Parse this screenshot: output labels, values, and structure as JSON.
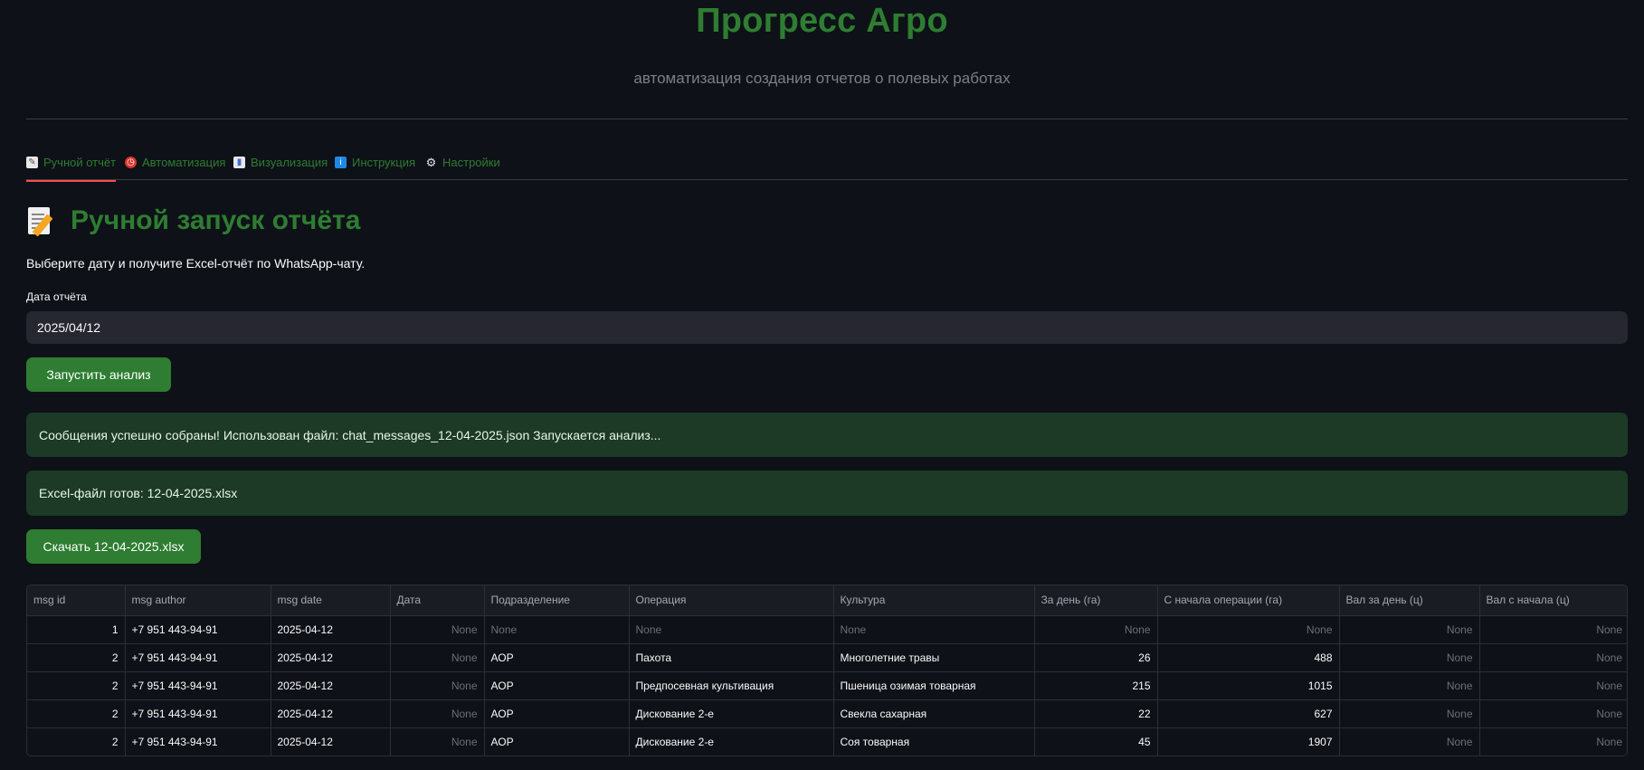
{
  "header": {
    "title": "Прогресс Агро",
    "subtitle": "автоматизация создания отчетов о полевых работах"
  },
  "tabs": [
    {
      "label": "Ручной отчёт",
      "icon": "memo-icon",
      "active": true
    },
    {
      "label": "Автоматизация",
      "icon": "alarm-clock-icon",
      "active": false
    },
    {
      "label": "Визуализация",
      "icon": "bar-chart-icon",
      "active": false
    },
    {
      "label": "Инструкция",
      "icon": "info-icon",
      "active": false
    },
    {
      "label": "Настройки",
      "icon": "gear-icon",
      "active": false
    }
  ],
  "section": {
    "title": "Ручной запуск отчёта",
    "description": "Выберите дату и получите Excel-отчёт по WhatsApp-чату."
  },
  "date_field": {
    "label": "Дата отчёта",
    "value": "2025/04/12"
  },
  "run_button_label": "Запустить анализ",
  "alerts": [
    "Сообщения успешно собраны! Использован файл: chat_messages_12-04-2025.json Запускается анализ...",
    "Excel-файл готов: 12-04-2025.xlsx"
  ],
  "download_button_label": "Скачать 12-04-2025.xlsx",
  "table": {
    "columns": [
      "msg id",
      "msg author",
      "msg date",
      "Дата",
      "Подразделение",
      "Операция",
      "Культура",
      "За день (га)",
      "С начала операции (га)",
      "Вал за день (ц)",
      "Вал с начала (ц)"
    ],
    "rows": [
      [
        "1",
        "+7 951 443-94-91",
        "2025-04-12",
        "None",
        "None",
        "None",
        "None",
        "None",
        "None",
        "None",
        "None"
      ],
      [
        "2",
        "+7 951 443-94-91",
        "2025-04-12",
        "None",
        "АОР",
        "Пахота",
        "Многолетние травы",
        "26",
        "488",
        "None",
        "None"
      ],
      [
        "2",
        "+7 951 443-94-91",
        "2025-04-12",
        "None",
        "АОР",
        "Предпосевная культивация",
        "Пшеница озимая товарная",
        "215",
        "1015",
        "None",
        "None"
      ],
      [
        "2",
        "+7 951 443-94-91",
        "2025-04-12",
        "None",
        "АОР",
        "Дискование 2-е",
        "Свекла сахарная",
        "22",
        "627",
        "None",
        "None"
      ],
      [
        "2",
        "+7 951 443-94-91",
        "2025-04-12",
        "None",
        "АОР",
        "Дискование 2-е",
        "Соя товарная",
        "45",
        "1907",
        "None",
        "None"
      ]
    ]
  },
  "colors": {
    "accent": "#2e7d32",
    "background": "#0e1117",
    "tab_underline": "#ff4b4b",
    "alert_bg": "#1c3a25",
    "input_bg": "#262730"
  }
}
